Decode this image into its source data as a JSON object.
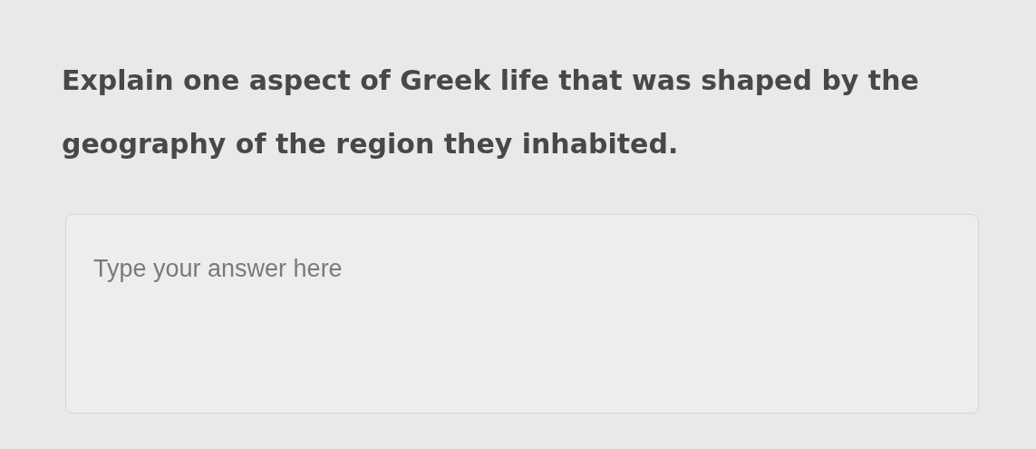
{
  "question": {
    "text": "Explain one aspect of Greek life that was shaped by the geography of the region they inhabited."
  },
  "answer": {
    "placeholder": "Type your answer here"
  }
}
